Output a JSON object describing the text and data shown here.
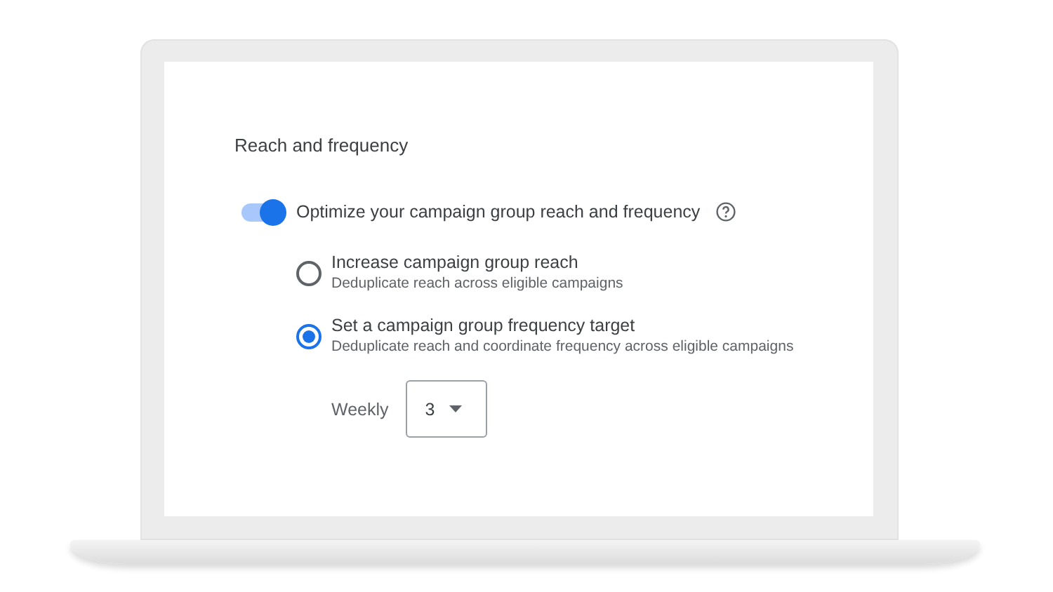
{
  "section": {
    "title": "Reach and frequency"
  },
  "toggle": {
    "label": "Optimize your campaign group reach and frequency",
    "on": true
  },
  "options": [
    {
      "title": "Increase campaign group reach",
      "description": "Deduplicate reach across eligible campaigns",
      "selected": false
    },
    {
      "title": "Set a campaign group frequency target",
      "description": "Deduplicate reach and coordinate frequency across eligible campaigns",
      "selected": true
    }
  ],
  "frequency": {
    "label": "Weekly",
    "value": "3"
  }
}
